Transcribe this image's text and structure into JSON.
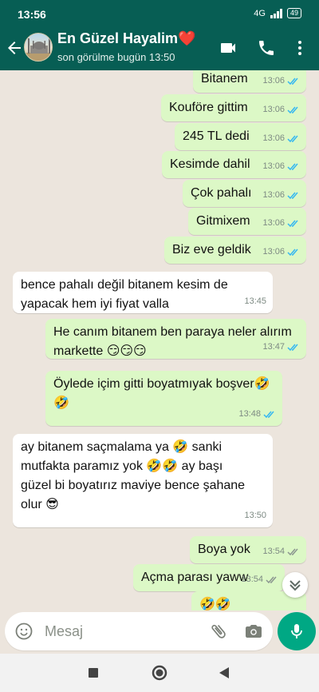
{
  "status_bar": {
    "time": "13:56",
    "network": "4G",
    "battery": "49"
  },
  "header": {
    "contact_name": "En Güzel Hayalim❤️",
    "contact_status": "son görülme bugün 13:50"
  },
  "messages": [
    {
      "dir": "out",
      "lines": [
        "Bitanem"
      ],
      "time": "13:06",
      "status": "read"
    },
    {
      "dir": "out",
      "lines": [
        "Kouföre gittim"
      ],
      "time": "13:06",
      "status": "read"
    },
    {
      "dir": "out",
      "lines": [
        "245 TL dedi"
      ],
      "time": "13:06",
      "status": "read"
    },
    {
      "dir": "out",
      "lines": [
        "Kesimde dahil"
      ],
      "time": "13:06",
      "status": "read"
    },
    {
      "dir": "out",
      "lines": [
        "Çok pahalı"
      ],
      "time": "13:06",
      "status": "read"
    },
    {
      "dir": "out",
      "lines": [
        "Gitmixem"
      ],
      "time": "13:06",
      "status": "read"
    },
    {
      "dir": "out",
      "lines": [
        "Biz eve geldik"
      ],
      "time": "13:06",
      "status": "read"
    },
    {
      "dir": "in",
      "lines": [
        "bence pahalı değil bitanem kesim de",
        "yapacak hem iyi fiyat valla"
      ],
      "time": "13:45"
    },
    {
      "dir": "out",
      "lines": [
        "He canım bitanem ben paraya neler alırım",
        "markette 😏😏😏"
      ],
      "time": "13:47",
      "status": "read"
    },
    {
      "dir": "out",
      "lines": [
        "Öylede içim gitti boyatmıyak boşver🤣",
        "🤣"
      ],
      "time": "13:48",
      "status": "read"
    },
    {
      "dir": "in",
      "lines": [
        "ay bitanem saçmalama ya 🤣 sanki",
        "mutfakta paramız yok 🤣🤣 ay başı",
        "güzel bi boyatırız maviye bence şahane",
        "olur 😎"
      ],
      "time": "13:50"
    },
    {
      "dir": "out",
      "lines": [
        "Boya yok"
      ],
      "time": "13:54",
      "status": "delivered"
    },
    {
      "dir": "out",
      "lines": [
        "Açma parası yaww"
      ],
      "time": "13:54",
      "status": "delivered"
    },
    {
      "dir": "out",
      "lines": [
        "🤣🤣"
      ],
      "time": "",
      "status": ""
    }
  ],
  "composer": {
    "placeholder": "Mesaj"
  },
  "icons": {
    "back": "arrow-left-icon",
    "video": "video-call-icon",
    "call": "phone-icon",
    "menu": "more-vert-icon",
    "emoji": "emoji-icon",
    "attach": "paperclip-icon",
    "camera": "camera-icon",
    "mic": "microphone-icon",
    "nav_back": "nav-back-icon",
    "nav_home": "nav-home-icon",
    "nav_recents": "nav-recents-icon",
    "scroll": "chevron-double-down-icon"
  },
  "colors": {
    "header": "#075e54",
    "outgoing": "#dcf8c6",
    "incoming": "#ffffff",
    "read_ticks": "#34b7f1",
    "fab": "#00a884",
    "chat_bg": "#ece5dd"
  }
}
